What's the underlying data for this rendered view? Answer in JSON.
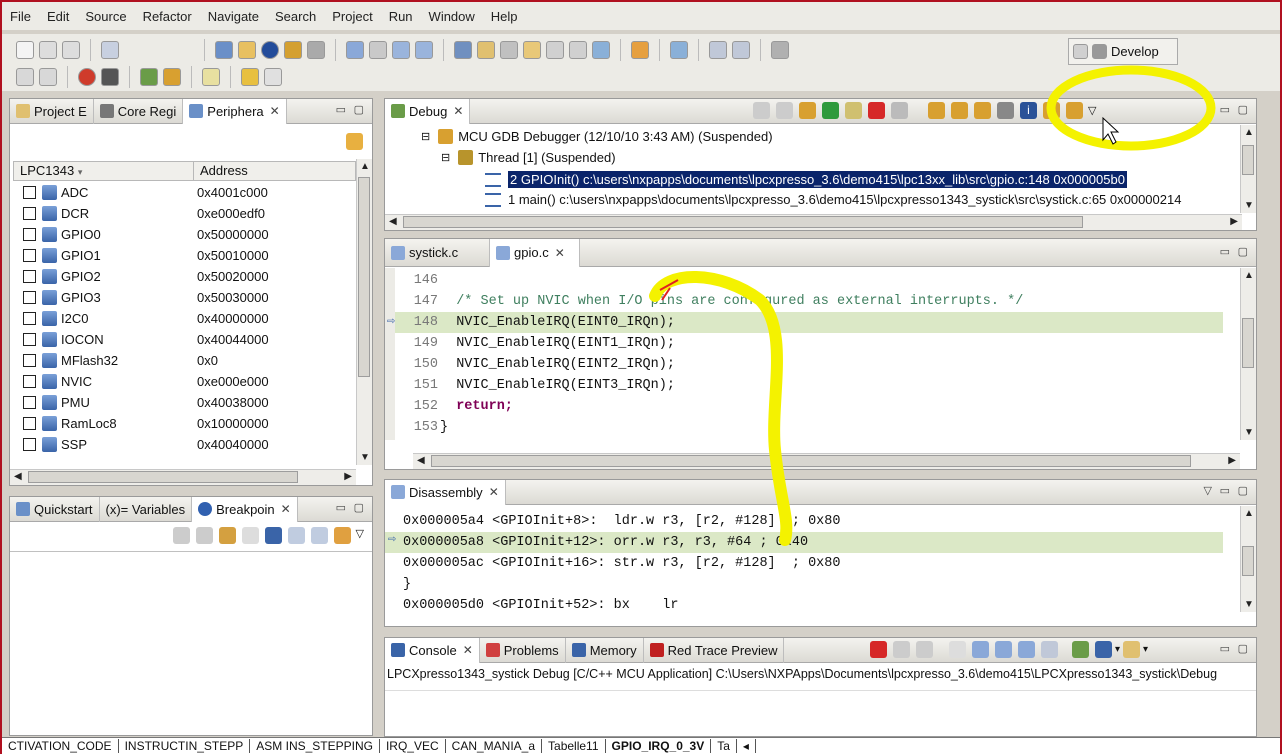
{
  "menu": [
    "File",
    "Edit",
    "Source",
    "Refactor",
    "Navigate",
    "Search",
    "Project",
    "Run",
    "Window",
    "Help"
  ],
  "perspective": {
    "label": "Develop"
  },
  "left_top": {
    "tabs": [
      "Project E",
      "Core Regi",
      "Periphera"
    ],
    "columns": [
      "LPC1343",
      "Address"
    ],
    "rows": [
      {
        "name": "ADC",
        "addr": "0x4001c000"
      },
      {
        "name": "DCR",
        "addr": "0xe000edf0"
      },
      {
        "name": "GPIO0",
        "addr": "0x50000000"
      },
      {
        "name": "GPIO1",
        "addr": "0x50010000"
      },
      {
        "name": "GPIO2",
        "addr": "0x50020000"
      },
      {
        "name": "GPIO3",
        "addr": "0x50030000"
      },
      {
        "name": "I2C0",
        "addr": "0x40000000"
      },
      {
        "name": "IOCON",
        "addr": "0x40044000"
      },
      {
        "name": "MFlash32",
        "addr": "0x0"
      },
      {
        "name": "NVIC",
        "addr": "0xe000e000"
      },
      {
        "name": "PMU",
        "addr": "0x40038000"
      },
      {
        "name": "RamLoc8",
        "addr": "0x10000000"
      },
      {
        "name": "SSP",
        "addr": "0x40040000"
      }
    ]
  },
  "left_bottom": {
    "tabs": [
      "Quickstart",
      "(x)= Variables",
      "Breakpoin"
    ]
  },
  "debug": {
    "tab": "Debug",
    "launch": "MCU GDB Debugger (12/10/10 3:43 AM) (Suspended)",
    "thread": "Thread [1] (Suspended)",
    "frames": [
      "2 GPIOInit() c:\\users\\nxpapps\\documents\\lpcxpresso_3.6\\demo415\\lpc13xx_lib\\src\\gpio.c:148 0x000005b0",
      "1 main() c:\\users\\nxpapps\\documents\\lpcxpresso_3.6\\demo415\\lpcxpresso1343_systick\\src\\systick.c:65 0x00000214"
    ]
  },
  "editor": {
    "tabs": [
      "systick.c",
      "gpio.c"
    ],
    "lines": [
      {
        "n": "146",
        "text": ""
      },
      {
        "n": "147",
        "text": "  /* Set up NVIC when I/O pins are configured as external interrupts. */"
      },
      {
        "n": "148",
        "text": "  NVIC_EnableIRQ(EINT0_IRQn);"
      },
      {
        "n": "149",
        "text": "  NVIC_EnableIRQ(EINT1_IRQn);"
      },
      {
        "n": "150",
        "text": "  NVIC_EnableIRQ(EINT2_IRQn);"
      },
      {
        "n": "151",
        "text": "  NVIC_EnableIRQ(EINT3_IRQn);"
      },
      {
        "n": "152",
        "text": "  return;"
      },
      {
        "n": "153",
        "text": "}"
      }
    ]
  },
  "disassembly": {
    "tab": "Disassembly",
    "lines": [
      "0x000005a4 <GPIOInit+8>:  ldr.w r3, [r2, #128]  ; 0x80",
      "0x000005a8 <GPIOInit+12>: orr.w r3, r3, #64 ; 0x40",
      "0x000005ac <GPIOInit+16>: str.w r3, [r2, #128]  ; 0x80",
      "}",
      "0x000005d0 <GPIOInit+52>: bx    lr"
    ]
  },
  "console": {
    "tabs": [
      "Console",
      "Problems",
      "Memory",
      "Red Trace Preview"
    ],
    "line": "LPCXpresso1343_systick Debug [C/C++ MCU Application] C:\\Users\\NXPApps\\Documents\\lpcxpresso_3.6\\demo415\\LPCXpresso1343_systick\\Debug"
  },
  "bottom_tabs": [
    "CTIVATION_CODE",
    "INSTRUCTIN_STEPP",
    "ASM INS_STEPPING",
    "IRQ_VEC",
    "CAN_MANIA_a",
    "Tabelle11",
    "GPIO_IRQ_0_3V",
    "Ta"
  ]
}
